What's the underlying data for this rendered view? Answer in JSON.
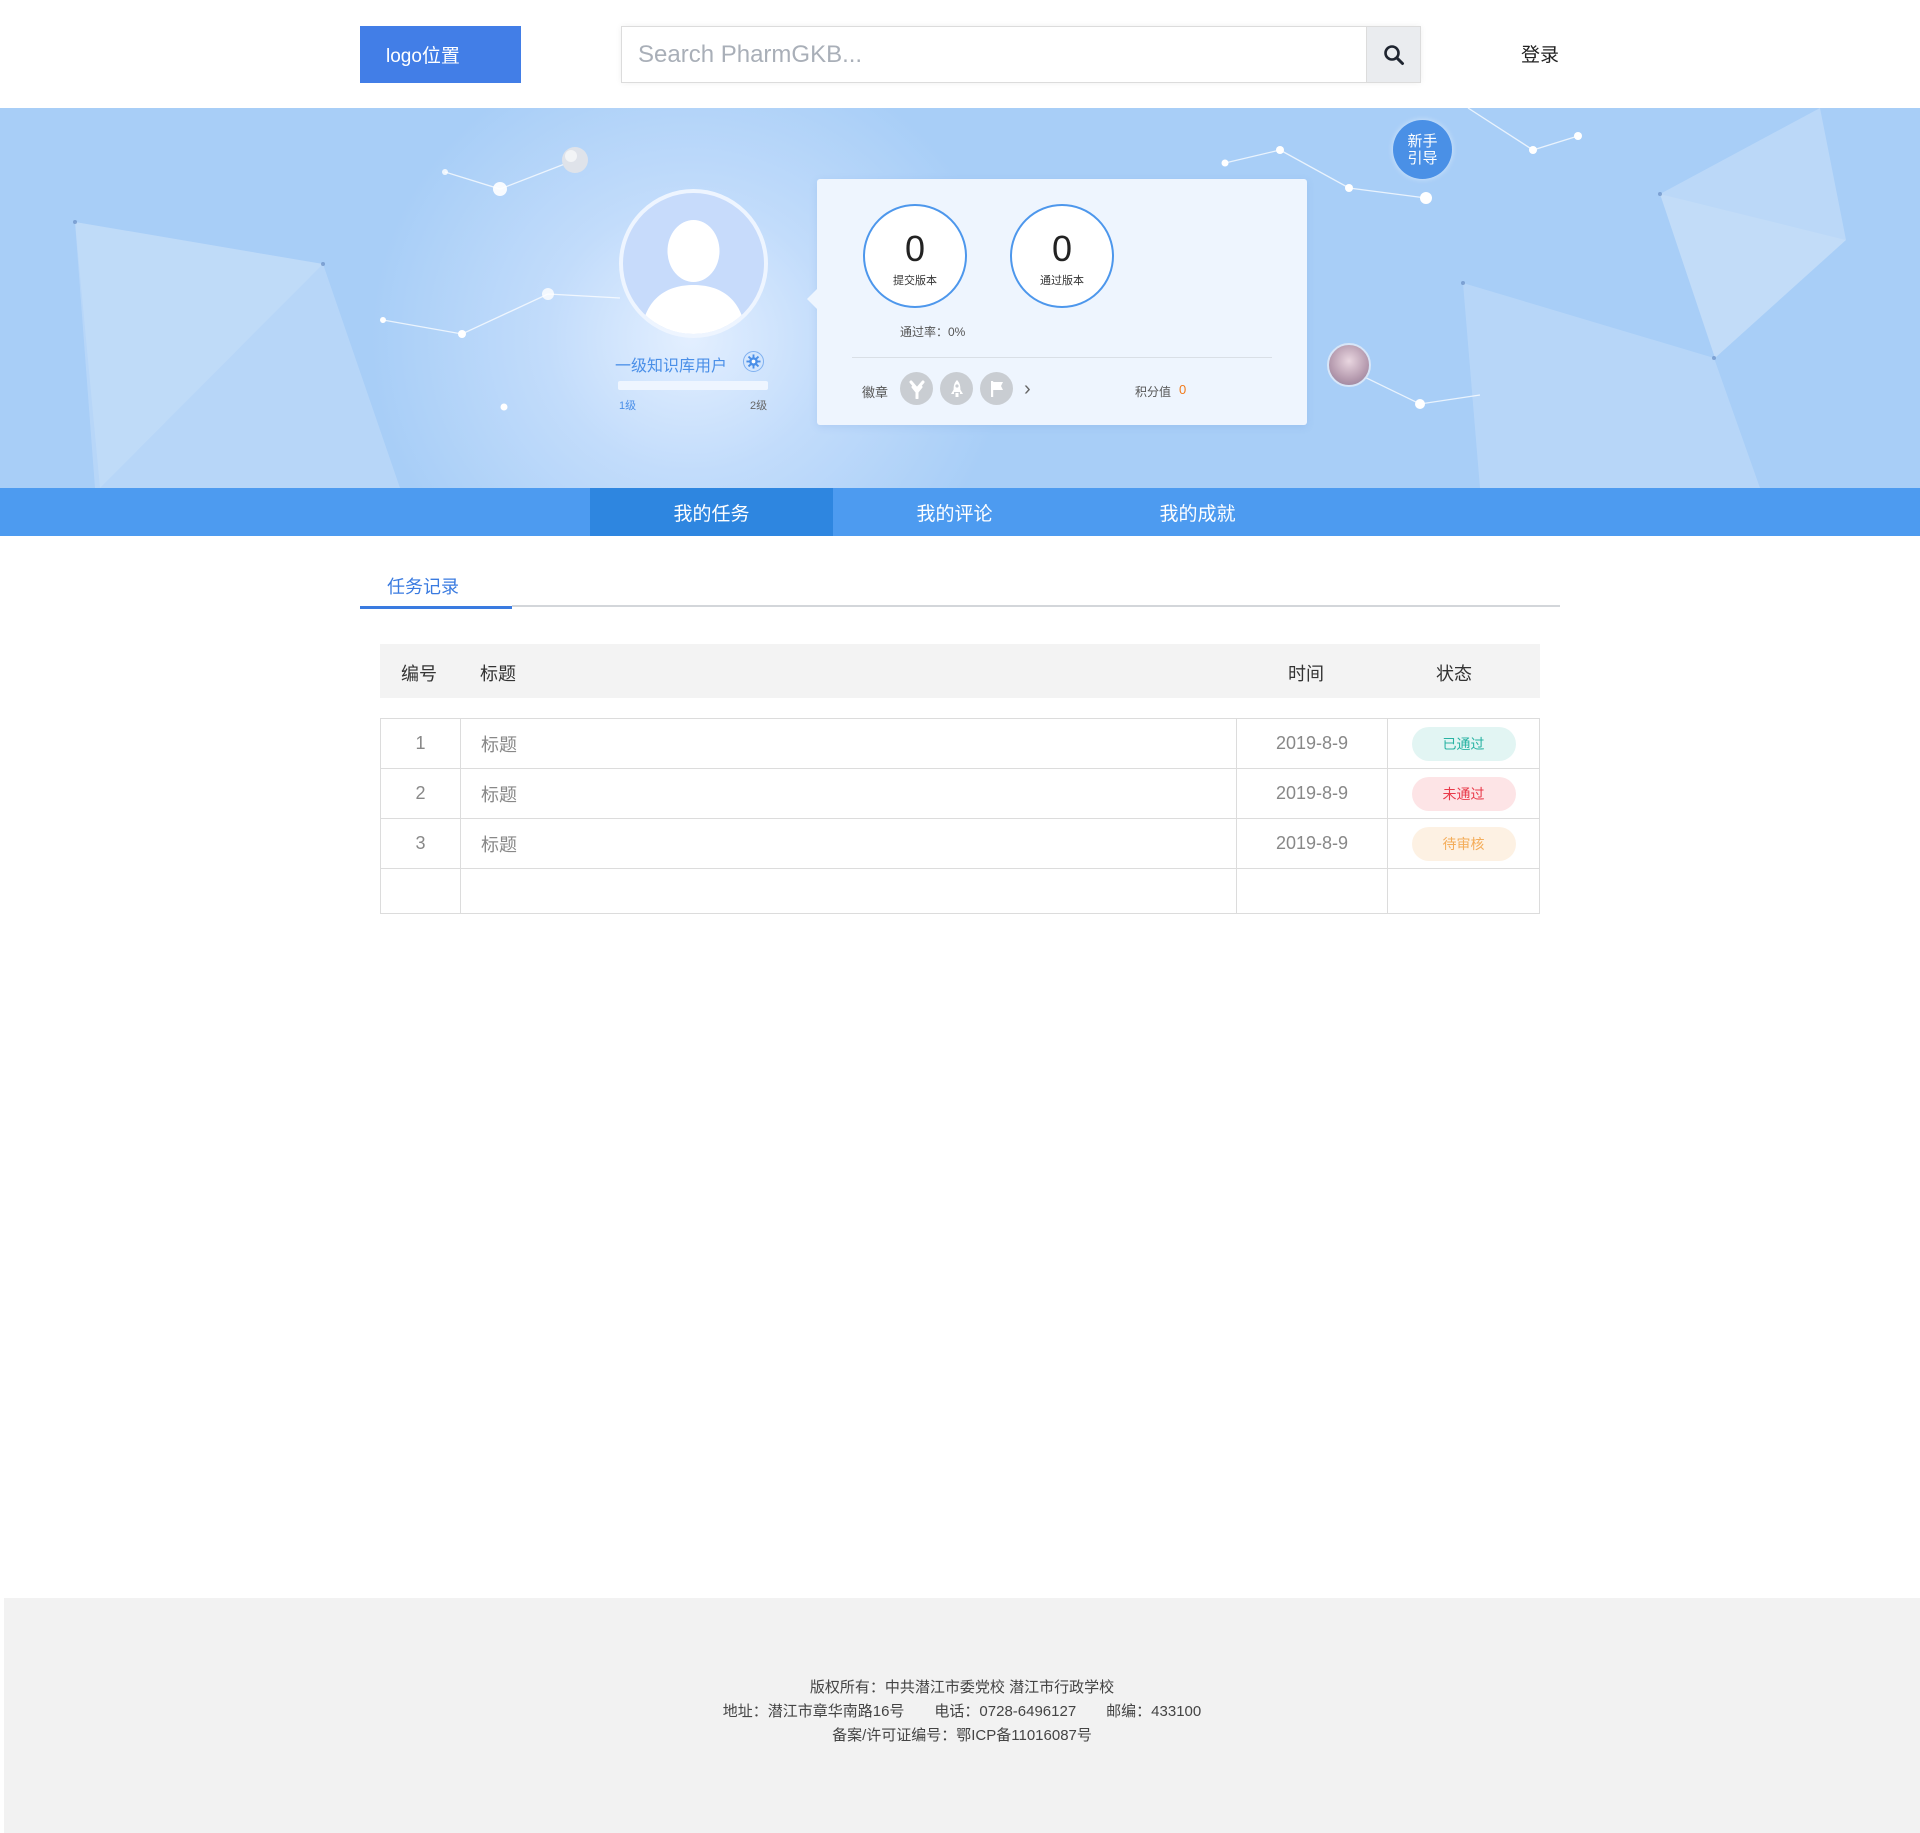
{
  "header": {
    "logo": "logo位置",
    "search_placeholder": "Search PharmGKB...",
    "login": "登录"
  },
  "profile": {
    "user_name": "一级知识库用户",
    "level_from": "1级",
    "level_to": "2级",
    "level_progress": 0,
    "stats": [
      {
        "value": "0",
        "label": "提交版本"
      },
      {
        "value": "0",
        "label": "通过版本"
      }
    ],
    "pass_rate": "通过率：0%",
    "badges_label": "徽章",
    "badges": [
      "tree-icon",
      "rocket-icon",
      "flag-icon"
    ],
    "score_label": "积分值",
    "score_value": "0",
    "guide": "新手引导"
  },
  "tabs": [
    {
      "label": "我的任务",
      "active": true
    },
    {
      "label": "我的评论",
      "active": false
    },
    {
      "label": "我的成就",
      "active": false
    }
  ],
  "subtab": "任务记录",
  "table": {
    "headers": {
      "id": "编号",
      "title": "标题",
      "time": "时间",
      "status": "状态"
    },
    "rows": [
      {
        "id": "1",
        "title": "标题",
        "time": "2019-8-9",
        "status": "已通过"
      },
      {
        "id": "2",
        "title": "标题",
        "time": "2019-8-9",
        "status": "未通过"
      },
      {
        "id": "3",
        "title": "标题",
        "time": "2019-8-9",
        "status": "待审核"
      }
    ]
  },
  "footer": {
    "line1": "版权所有：中共潜江市委党校 潜江市行政学校",
    "line2": "地址：潜江市章华南路16号　　电话：0728-6496127　　邮编：433100",
    "line3": "备案/许可证编号：鄂ICP备11016087号"
  },
  "colors": {
    "brand": "#427ee7",
    "tab_bar": "#4d9bf0",
    "tab_active": "#2e86e0",
    "pass": "#29b3a3",
    "fail": "#e93a4a",
    "pending": "#f4ad5a",
    "score": "#f07a1a"
  }
}
